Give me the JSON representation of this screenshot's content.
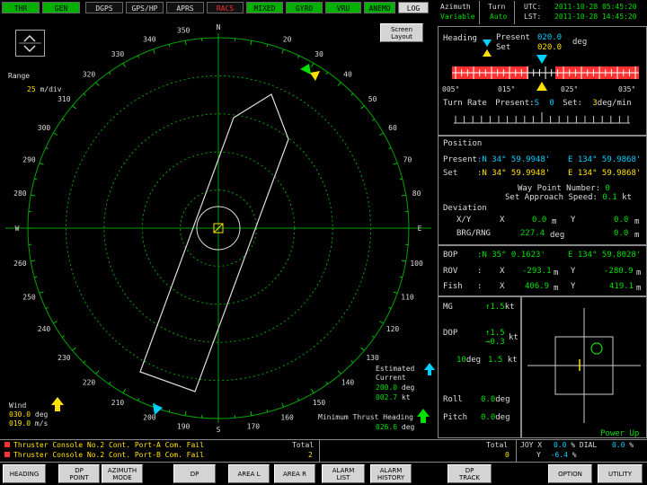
{
  "tabs": [
    {
      "label": "THR",
      "style": "green"
    },
    {
      "label": "GEN",
      "style": "green"
    },
    {
      "label": "DGPS",
      "style": "dark"
    },
    {
      "label": "GPS/HP",
      "style": "dark"
    },
    {
      "label": "APRS",
      "style": "dark"
    },
    {
      "label": "RACS",
      "style": "dark",
      "color": "#ff3030"
    },
    {
      "label": "MIXED",
      "style": "green"
    },
    {
      "label": "GYRO",
      "style": "green"
    },
    {
      "label": "VRU",
      "style": "green"
    },
    {
      "label": "ANEMO",
      "style": "green"
    },
    {
      "label": "LOG",
      "style": "gray"
    }
  ],
  "mode": {
    "azimuth_label": "Azimuth",
    "azimuth_value": "Variable",
    "turn_label": "Turn",
    "turn_value": "Auto"
  },
  "time": {
    "utc_label": "UTC:",
    "utc_value": "2011-10-28 05:45:20",
    "lst_label": "LST:",
    "lst_value": "2011-10-28 14:45:20"
  },
  "radar": {
    "compass": [
      "N",
      "20",
      "30",
      "40",
      "50",
      "60",
      "70",
      "80",
      "E",
      "100",
      "110",
      "120",
      "130",
      "140",
      "150",
      "160",
      "170",
      "S",
      "190",
      "200",
      "210",
      "220",
      "230",
      "240",
      "250",
      "260",
      "W",
      "280",
      "290",
      "300",
      "310",
      "320",
      "330",
      "340",
      "350"
    ],
    "range_label": "Range",
    "range_value": "25",
    "range_unit": "m/div",
    "screen_layout": "Screen\nLayout",
    "wind_label": "Wind",
    "wind_dir": "030.0",
    "wind_dir_unit": "deg",
    "wind_speed": "019.0",
    "wind_speed_unit": "m/s",
    "current_label": "Estimated\nCurrent",
    "current_dir": "200.0",
    "current_dir_unit": "deg",
    "current_speed": "002.7",
    "current_speed_unit": "kt",
    "min_thrust_label": "Minimum Thrust Heading",
    "min_thrust_value": "026.6",
    "min_thrust_unit": "deg"
  },
  "heading": {
    "title": "Heading",
    "present_label": "Present",
    "present_value": "020.0",
    "unit": "deg",
    "set_label": "Set",
    "set_value": "020.0",
    "ticks": [
      "005°",
      "015°",
      "025°",
      "035°"
    ],
    "turn_rate_label": "Turn Rate",
    "turn_present_label": "Present:",
    "turn_present_sign": "S",
    "turn_present_value": "0",
    "turn_set_label": "Set:",
    "turn_set_value": "3",
    "turn_unit": "deg/min"
  },
  "position": {
    "title": "Position",
    "present_label": "Present",
    "present_lat": ":N  34° 59.9948'",
    "present_lon": "E 134° 59.9868'",
    "set_label": "Set",
    "set_lat": ":N  34° 59.9948'",
    "set_lon": "E 134° 59.9868'",
    "wp_label": "Way Point Number:",
    "wp_value": "0",
    "approach_label": "Set Approach Speed:",
    "approach_value": "0.1",
    "approach_unit": "kt",
    "deviation_title": "Deviation",
    "xy_label": "X/Y",
    "x_label": "X",
    "x_value": "0.0",
    "x_unit": "m",
    "y_label": "Y",
    "y_value": "0.0",
    "y_unit": "m",
    "brg_label": "BRG/RNG",
    "brg_value": "227.4",
    "brg_unit": "deg",
    "rng_value": "0.0",
    "rng_unit": "m"
  },
  "bop": {
    "bop_label": "BOP",
    "bop_lat": ":N  35° 0.1623'",
    "bop_lon": "E 134° 59.8028'",
    "rov_label": "ROV",
    "rov_sep": ":",
    "rov_x_label": "X",
    "rov_x": "-293.1",
    "rov_y_label": "Y",
    "rov_y": "-280.9",
    "unit": "m",
    "fish_label": "Fish",
    "fish_sep": ":",
    "fish_x_label": "X",
    "fish_x": "406.9",
    "fish_y_label": "Y",
    "fish_y": "419.1"
  },
  "motion": {
    "mg_label": "MG",
    "mg_value": "↑1.5",
    "mg_unit": "kt",
    "dop_label": "DOP",
    "dop_v1": "↑1.5",
    "dop_v2": "→0.3",
    "dop_unit": "kt",
    "dop_heading": "10",
    "dop_heading_unit": "deg",
    "dop_speed": "1.5",
    "dop_speed_unit": "kt",
    "roll_label": "Roll",
    "roll_value": "0.0",
    "roll_unit": "deg",
    "pitch_label": "Pitch",
    "pitch_value": "0.0",
    "pitch_unit": "deg",
    "power_up": "Power Up"
  },
  "alarms": {
    "items": [
      "Thruster Console No.2 Cont. Port-A Com. Fail",
      "Thruster Console No.2 Cont. Port-B Com. Fail"
    ],
    "total_label": "Total",
    "total_value": "2",
    "total2_label": "Total",
    "total2_value": "0"
  },
  "joy": {
    "joy_label": "JOY",
    "x_label": "X",
    "x_value": "0.0",
    "x_unit": "%",
    "y_label": "Y",
    "y_value": "-6.4",
    "y_unit": "%",
    "dial_label": "DIAL",
    "dial_value": "0.0",
    "dial_unit": "%"
  },
  "buttons": [
    {
      "label": "HEADING",
      "name": "heading-button"
    },
    {
      "label": "DP\nPOINT",
      "name": "dp-point-button"
    },
    {
      "label": "AZIMUTH\nMODE",
      "name": "azimuth-mode-button"
    },
    {
      "label": "DP",
      "name": "dp-button"
    },
    {
      "label": "AREA L",
      "name": "area-l-button"
    },
    {
      "label": "AREA R",
      "name": "area-r-button"
    },
    {
      "label": "ALARM\nLIST",
      "name": "alarm-list-button"
    },
    {
      "label": "ALARM\nHISTORY",
      "name": "alarm-history-button"
    },
    {
      "label": "DP\nTRACK",
      "name": "dp-track-button"
    },
    {
      "label": "OPTION",
      "name": "option-button"
    },
    {
      "label": "UTILITY",
      "name": "utility-button"
    }
  ],
  "colors": {
    "accent_cyan": "#00d0ff",
    "accent_green": "#00e000",
    "accent_yellow": "#ffe000",
    "alarm_red": "#ff3030",
    "heading_bar": "#ff3030"
  }
}
